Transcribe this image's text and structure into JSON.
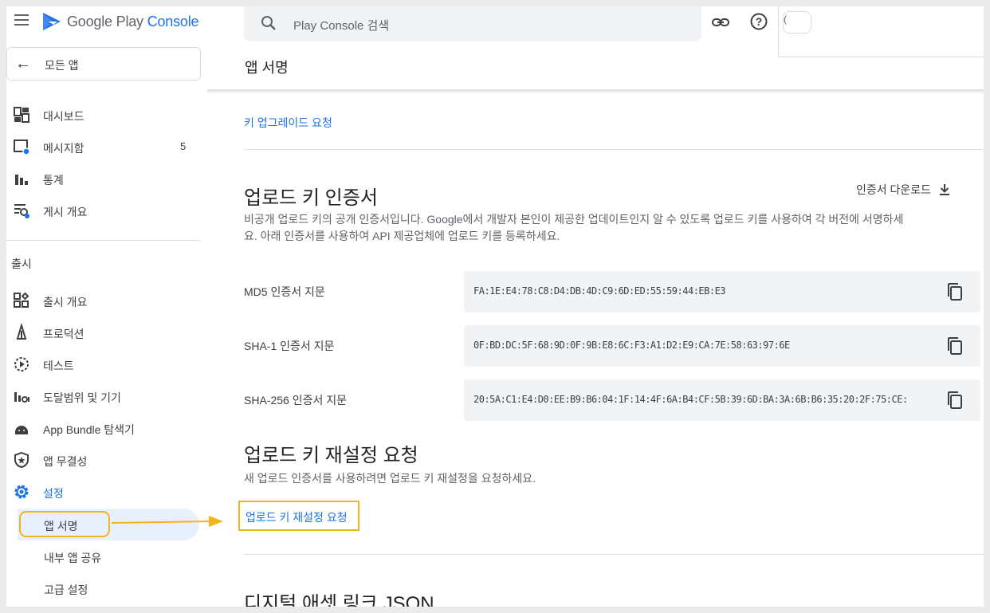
{
  "app": {
    "brand_prefix": "Google Play",
    "brand_suffix": "Console"
  },
  "search": {
    "placeholder": "Play Console 검색"
  },
  "account": {
    "chip_text": "("
  },
  "sidebar": {
    "back_label": "모든 앱",
    "items": [
      {
        "label": "대시보드"
      },
      {
        "label": "메시지함",
        "badge": "5"
      },
      {
        "label": "통계"
      },
      {
        "label": "게시 개요"
      }
    ],
    "section_title": "출시",
    "release_items": [
      {
        "label": "출시 개요"
      },
      {
        "label": "프로덕션"
      },
      {
        "label": "테스트"
      },
      {
        "label": "도달범위 및 기기"
      },
      {
        "label": "App Bundle 탐색기"
      },
      {
        "label": "앱 무결성"
      },
      {
        "label": "설정"
      }
    ],
    "settings_sub": [
      {
        "label": "앱 서명"
      },
      {
        "label": "내부 앱 공유"
      },
      {
        "label": "고급 설정"
      }
    ]
  },
  "page": {
    "title": "앱 서명",
    "upgrade_link": "키 업그레이드 요청"
  },
  "upload_cert": {
    "heading": "업로드 키 인증서",
    "download_label": "인증서 다운로드",
    "description_line1": "비공개 업로드 키의 공개 인증서입니다. Google에서 개발자 본인이 제공한 업데이트인지 알 수 있도록 업로드 키를 사용하여 각 버전에 서명하세",
    "description_line2": "요. 아래 인증서를 사용하여 API 제공업체에 업로드 키를 등록하세요.",
    "fingerprints": [
      {
        "label": "MD5 인증서 지문",
        "value": "FA:1E:E4:78:C8:D4:DB:4D:C9:6D:ED:55:59:44:EB:E3"
      },
      {
        "label": "SHA-1 인증서 지문",
        "value": "0F:BD:DC:5F:68:9D:0F:9B:E8:6C:F3:A1:D2:E9:CA:7E:58:63:97:6E"
      },
      {
        "label": "SHA-256 인증서 지문",
        "value": "20:5A:C1:E4:D0:EE:B9:B6:04:1F:14:4F:6A:B4:CF:5B:39:6D:BA:3A:6B:B6:35:20:2F:75:CE:"
      }
    ]
  },
  "reset": {
    "heading": "업로드 키 재설정 요청",
    "description": "새 업로드 인증서를 사용하려면 업로드 키 재설정을 요청하세요.",
    "link": "업로드 키 재설정 요청"
  },
  "next_section": {
    "heading": "디지털 애셋 링크 JSON"
  },
  "colors": {
    "accent": "#1a73e8",
    "highlight": "#f2b41b",
    "active_bg": "#e8f0fe"
  }
}
